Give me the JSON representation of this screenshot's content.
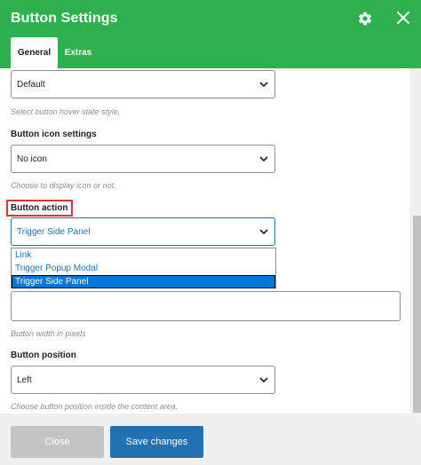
{
  "header": {
    "title": "Button Settings",
    "settings_icon": "gear-icon",
    "close_icon": "close-icon",
    "bg_color": "#2db04d"
  },
  "tabs": [
    {
      "label": "General",
      "active": true
    },
    {
      "label": "Extras",
      "active": false
    }
  ],
  "fields": {
    "hover_state": {
      "value": "Default",
      "help": "Select button hover state style."
    },
    "icon_settings": {
      "label": "Button icon settings",
      "value": "No icon",
      "help": "Choose to display icon or not."
    },
    "action": {
      "label": "Button action",
      "value": "Trigger Side Panel",
      "options": [
        "Link",
        "Trigger Popup Modal",
        "Trigger Side Panel"
      ],
      "selected_index": 2
    },
    "width": {
      "value": "",
      "help": "Button width in pixels"
    },
    "position": {
      "label": "Button position",
      "value": "Left",
      "help": "Choose button position inside the content area."
    }
  },
  "footer": {
    "close_label": "Close",
    "save_label": "Save changes"
  },
  "colors": {
    "accent": "#2271b1",
    "highlight": "#d63638"
  }
}
